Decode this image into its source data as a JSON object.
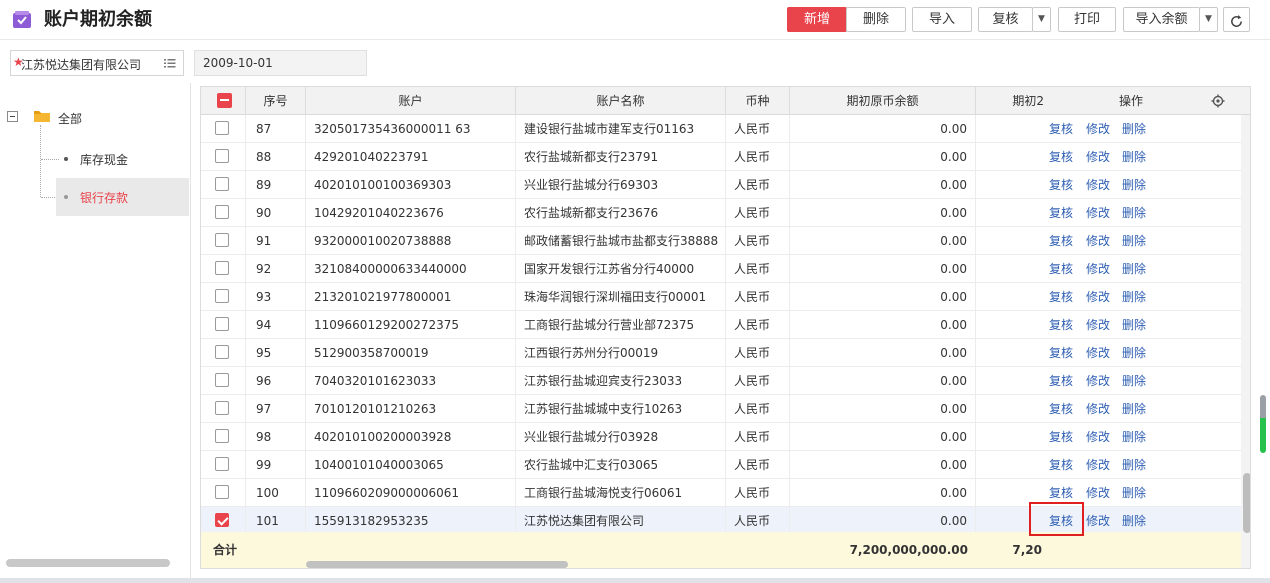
{
  "header": {
    "title": "账户期初余额",
    "buttons": {
      "add": "新增",
      "delete": "删除",
      "import": "导入",
      "review": "复核",
      "print": "打印",
      "import_balance": "导入余额"
    }
  },
  "filters": {
    "company_required_mark": "★",
    "company": "江苏悦达集团有限公司",
    "date": "2009-10-01"
  },
  "tree": {
    "root": "全部",
    "children": [
      "库存现金",
      "银行存款"
    ],
    "selected": "银行存款"
  },
  "grid": {
    "columns": [
      "序号",
      "账户",
      "账户名称",
      "币种",
      "期初原币余额",
      "期初本",
      "操作"
    ],
    "visible_column_headers": {
      "seq": "序号",
      "account": "账户",
      "account_name": "账户名称",
      "currency": "币种",
      "balance": "期初原币余额",
      "balance_local": "期初2",
      "actions": "操作"
    },
    "actions": {
      "review": "复核",
      "edit": "修改",
      "delete": "删除"
    },
    "rows": [
      {
        "seq": "87",
        "account": "320501735436000011 63",
        "name": "建设银行盐城市建军支行01163",
        "currency": "人民币",
        "balance": "0.00",
        "checked": false
      },
      {
        "seq": "88",
        "account": "429201040223791",
        "name": "农行盐城新都支行23791",
        "currency": "人民币",
        "balance": "0.00",
        "checked": false
      },
      {
        "seq": "89",
        "account": "402010100100369303",
        "name": "兴业银行盐城分行69303",
        "currency": "人民币",
        "balance": "0.00",
        "checked": false
      },
      {
        "seq": "90",
        "account": "10429201040223676",
        "name": "农行盐城新都支行23676",
        "currency": "人民币",
        "balance": "0.00",
        "checked": false
      },
      {
        "seq": "91",
        "account": "932000010020738888",
        "name": "邮政储蓄银行盐城市盐都支行38888",
        "currency": "人民币",
        "balance": "0.00",
        "checked": false
      },
      {
        "seq": "92",
        "account": "32108400000633440000",
        "name": "国家开发银行江苏省分行40000",
        "currency": "人民币",
        "balance": "0.00",
        "checked": false
      },
      {
        "seq": "93",
        "account": "213201021977800001",
        "name": "珠海华润银行深圳福田支行00001",
        "currency": "人民币",
        "balance": "0.00",
        "checked": false
      },
      {
        "seq": "94",
        "account": "1109660129200272375",
        "name": "工商银行盐城分行营业部72375",
        "currency": "人民币",
        "balance": "0.00",
        "checked": false
      },
      {
        "seq": "95",
        "account": "512900358700019",
        "name": "江西银行苏州分行00019",
        "currency": "人民币",
        "balance": "0.00",
        "checked": false
      },
      {
        "seq": "96",
        "account": "7040320101623033",
        "name": "江苏银行盐城迎宾支行23033",
        "currency": "人民币",
        "balance": "0.00",
        "checked": false
      },
      {
        "seq": "97",
        "account": "7010120101210263",
        "name": "江苏银行盐城城中支行10263",
        "currency": "人民币",
        "balance": "0.00",
        "checked": false
      },
      {
        "seq": "98",
        "account": "402010100200003928",
        "name": "兴业银行盐城分行03928",
        "currency": "人民币",
        "balance": "0.00",
        "checked": false
      },
      {
        "seq": "99",
        "account": "10400101040003065",
        "name": "农行盐城中汇支行03065",
        "currency": "人民币",
        "balance": "0.00",
        "checked": false
      },
      {
        "seq": "100",
        "account": "1109660209000006061",
        "name": "工商银行盐城海悦支行06061",
        "currency": "人民币",
        "balance": "0.00",
        "checked": false
      },
      {
        "seq": "101",
        "account": "155913182953235",
        "name": "江苏悦达集团有限公司",
        "currency": "人民币",
        "balance": "0.00",
        "checked": true
      }
    ],
    "total": {
      "label": "合计",
      "balance": "7,200,000,000.00",
      "balance_local": "7,20"
    }
  },
  "colors": {
    "accent": "#e9434b",
    "link": "#2f5fb3",
    "total_bg": "#fdf9dd"
  },
  "icons": [
    "app-icon",
    "list-icon",
    "folder-icon",
    "gear-icon",
    "refresh-icon",
    "chevron-down-icon"
  ]
}
